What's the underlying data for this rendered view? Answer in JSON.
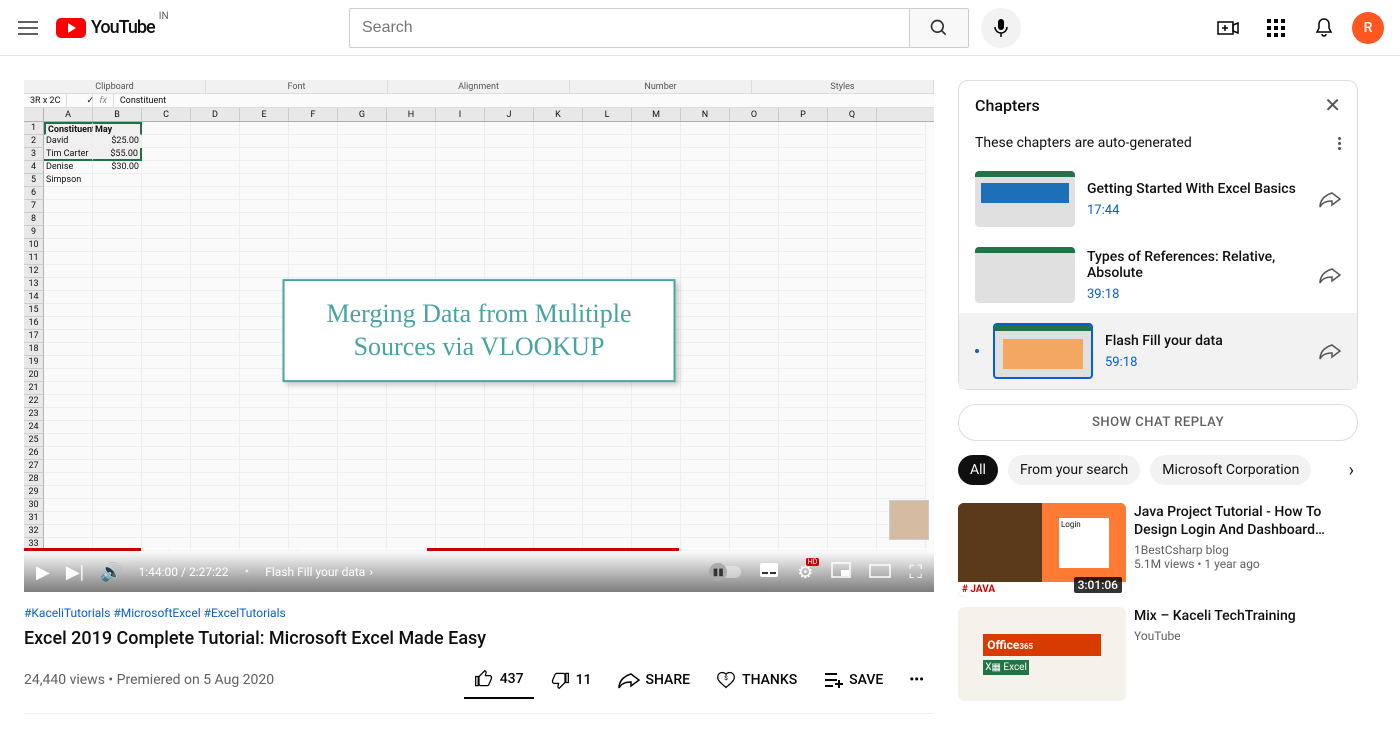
{
  "header": {
    "logo_text": "YouTube",
    "country": "IN",
    "search_placeholder": "Search",
    "avatar_initial": "R"
  },
  "excel": {
    "ribbon": [
      "Clipboard",
      "Font",
      "Alignment",
      "Number",
      "Styles"
    ],
    "ref_box": "3R x 2C",
    "formula_cell": "Constituent",
    "columns": [
      "A",
      "B",
      "C",
      "D",
      "E",
      "F",
      "G",
      "H",
      "I",
      "J",
      "K",
      "L",
      "M",
      "N",
      "O",
      "P",
      "Q"
    ],
    "rows": [
      {
        "num": 1,
        "a": "Constituent",
        "b": "May"
      },
      {
        "num": 2,
        "a": "David Jones",
        "b": "$25.00"
      },
      {
        "num": 3,
        "a": "Tim Carter",
        "b": "$55.00"
      },
      {
        "num": 4,
        "a": "Denise Simpson",
        "b": "$30.00"
      }
    ],
    "overlay_line1": "Merging Data from Mulitiple",
    "overlay_line2": "Sources via VLOOKUP"
  },
  "player": {
    "current_time": "1:44:00",
    "duration": "2:27:22",
    "chapter_label": "Flash Fill your data",
    "hd_label": "HD"
  },
  "video": {
    "tags": "#KaceliTutorials #MicrosoftExcel #ExcelTutorials",
    "title": "Excel 2019 Complete Tutorial: Microsoft Excel Made Easy",
    "views": "24,440 views",
    "dot": "•",
    "premiered": "Premiered on 5 Aug 2020"
  },
  "actions": {
    "likes": "437",
    "dislikes": "11",
    "share": "SHARE",
    "thanks": "THANKS",
    "save": "SAVE"
  },
  "chapters": {
    "heading": "Chapters",
    "subtitle": "These chapters are auto-generated",
    "items": [
      {
        "title": "Getting Started With Excel Basics",
        "time": "17:44"
      },
      {
        "title": "Types of References: Relative, Absolute",
        "time": "39:18"
      },
      {
        "title": "Flash Fill your data",
        "time": "59:18"
      }
    ]
  },
  "chat_replay": "SHOW CHAT REPLAY",
  "chips": {
    "all": "All",
    "from": "From your search",
    "ms": "Microsoft Corporation"
  },
  "recs": [
    {
      "title": "Java Project Tutorial - How To Design Login And Dashboard…",
      "channel": "1BestCsharp blog",
      "meta": "5.1M views • 1 year ago",
      "duration": "3:01:06"
    },
    {
      "title": "Mix – Kaceli TechTraining",
      "channel": "YouTube",
      "meta": "",
      "duration": ""
    }
  ]
}
